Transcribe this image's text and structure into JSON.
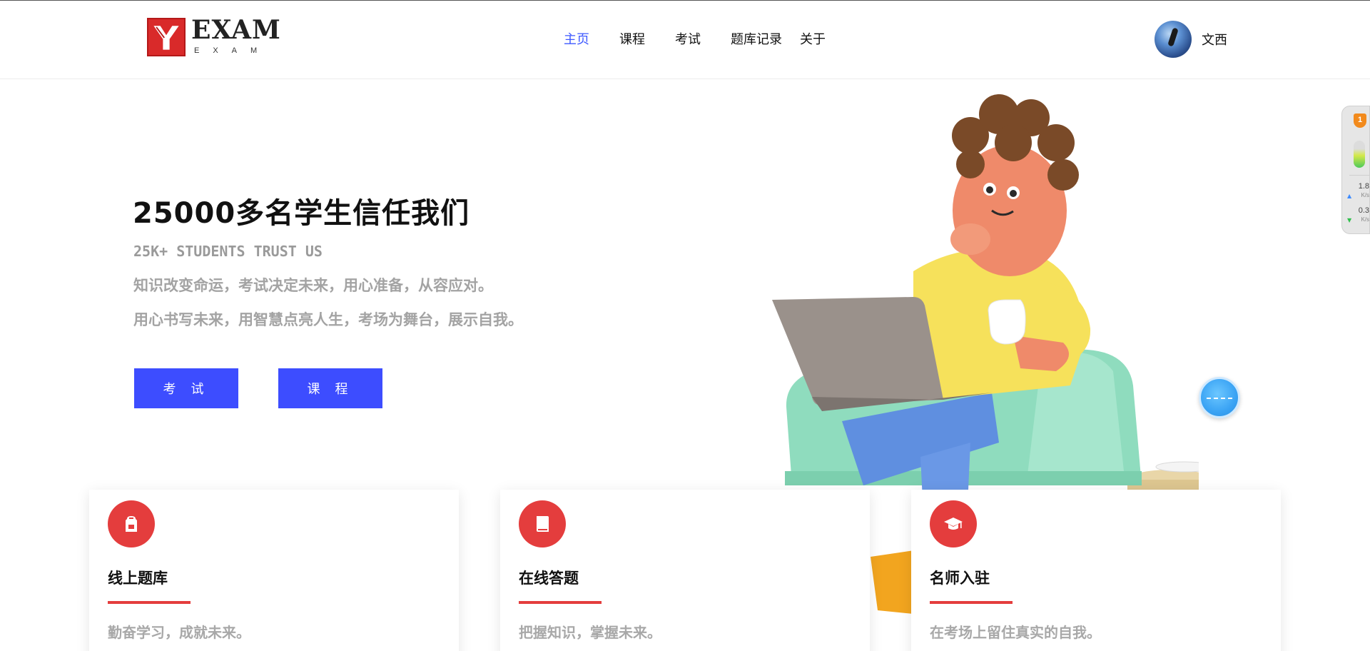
{
  "header": {
    "logo": {
      "word": "EXAM",
      "sub": "EXAM"
    },
    "nav": [
      {
        "label": "主页",
        "active": true
      },
      {
        "label": "课程",
        "active": false
      },
      {
        "label": "考试",
        "active": false
      },
      {
        "label": "题库记录",
        "active": false
      },
      {
        "label": "关于",
        "active": false
      }
    ],
    "user": {
      "name": "文西"
    }
  },
  "hero": {
    "title": "25000多名学生信任我们",
    "subtitle": "25K+ STUDENTS TRUST US",
    "line1": "知识改变命运，考试决定未来，用心准备，从容应对。",
    "line2": "用心书写未来，用智慧点亮人生，考场为舞台，展示自我。",
    "buttons": {
      "exam": "考 试",
      "course": "课 程"
    }
  },
  "features": [
    {
      "icon": "backpack-icon",
      "title": "线上题库",
      "desc": "勤奋学习，成就未来。"
    },
    {
      "icon": "book-icon",
      "title": "在线答题",
      "desc": "把握知识，掌握未来。"
    },
    {
      "icon": "graduation-cap-icon",
      "title": "名师入驻",
      "desc": "在考场上留住真实的自我。"
    }
  ],
  "side_widget": {
    "badge": "1",
    "upload": "1.8",
    "upload_unit": "K/s",
    "download": "0.3",
    "download_unit": "K/s"
  },
  "colors": {
    "accent": "#3d4dff",
    "nav_active": "#3d58ff",
    "feature_red": "#e43d3d",
    "muted_text": "#a3a3a3"
  }
}
